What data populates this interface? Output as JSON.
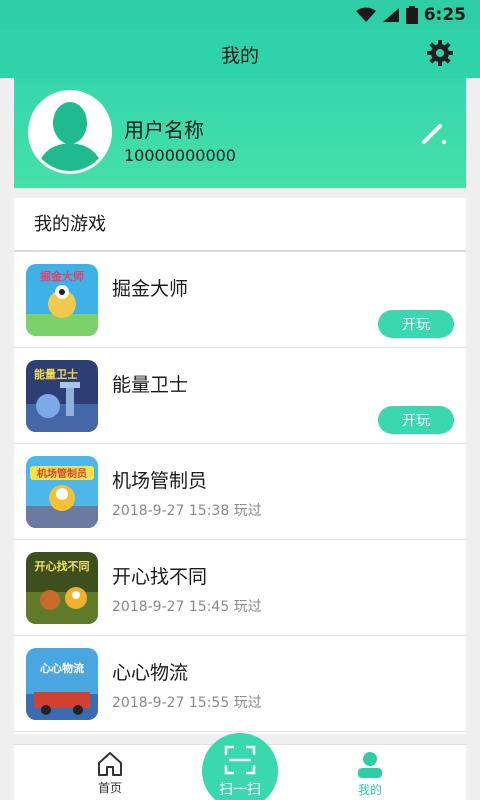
{
  "status": {
    "time": "6:25"
  },
  "header": {
    "title": "我的"
  },
  "profile": {
    "name": "用户名称",
    "phone": "10000000000"
  },
  "games_section": {
    "title": "我的游戏",
    "items": [
      {
        "name": "掘金大师",
        "meta": "",
        "play_label": "开玩",
        "thumb_text": "掘金大师",
        "thumb_color": "#3db2e6"
      },
      {
        "name": "能量卫士",
        "meta": "",
        "play_label": "开玩",
        "thumb_text": "能量卫士",
        "thumb_color": "#4467a8"
      },
      {
        "name": "机场管制员",
        "meta": "2018-9-27 15:38 玩过",
        "play_label": "",
        "thumb_text": "机场管制员",
        "thumb_color": "#4cb7e8"
      },
      {
        "name": "开心找不同",
        "meta": "2018-9-27 15:45 玩过",
        "play_label": "",
        "thumb_text": "开心找不同",
        "thumb_color": "#5f7b2a"
      },
      {
        "name": "心心物流",
        "meta": "2018-9-27 15:55 玩过",
        "play_label": "",
        "thumb_text": "心心物流",
        "thumb_color": "#4aa6e0"
      }
    ]
  },
  "tabbar": {
    "home_label": "首页",
    "scan_label": "扫一扫",
    "mine_label": "我的"
  },
  "colors": {
    "accent": "#2fd3a9",
    "button": "#3ad9ad"
  },
  "icons": [
    "wifi-icon",
    "signal-icon",
    "battery-icon",
    "gear-icon",
    "edit-icon",
    "home-icon",
    "scan-icon",
    "user-icon"
  ]
}
